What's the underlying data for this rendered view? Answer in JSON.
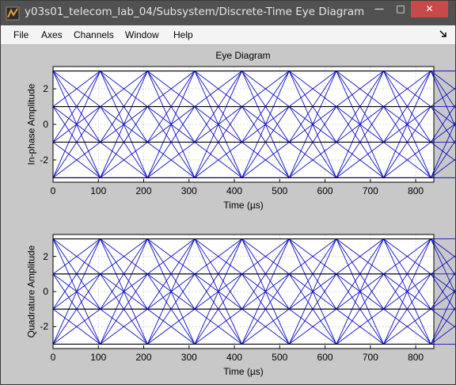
{
  "window": {
    "title": "y03s01_telecom_lab_04/Subsystem/Discrete-Time Eye Diagram ...",
    "minimize_glyph": "—",
    "maximize_glyph": "□",
    "close_glyph": "✕"
  },
  "menu": [
    "File",
    "Axes",
    "Channels",
    "Window",
    "Help"
  ],
  "plot_title": "Eye Diagram",
  "colors": {
    "trace": "#1010c8",
    "level": "#000000",
    "grid": "#cfcfcf",
    "background": "#c8c8c8"
  },
  "chart_data": [
    {
      "type": "line",
      "title": "Eye Diagram",
      "xlabel": "Time (µs)",
      "ylabel": "In-phase Amplitude",
      "xlim": [
        0,
        840
      ],
      "ylim": [
        -3.25,
        3.25
      ],
      "x_ticks": [
        0,
        100,
        200,
        300,
        400,
        500,
        600,
        700,
        800
      ],
      "y_ticks": [
        2,
        0,
        -2
      ],
      "symbol_period": 104.17,
      "levels": [
        -3,
        -1,
        1,
        3
      ],
      "grid": true
    },
    {
      "type": "line",
      "title": "",
      "xlabel": "Time (µs)",
      "ylabel": "Quadrature Amplitude",
      "xlim": [
        0,
        840
      ],
      "ylim": [
        -3.25,
        3.25
      ],
      "x_ticks": [
        0,
        100,
        200,
        300,
        400,
        500,
        600,
        700,
        800
      ],
      "y_ticks": [
        2,
        0,
        -2
      ],
      "symbol_period": 104.17,
      "levels": [
        -3,
        -1,
        1,
        3
      ],
      "grid": true
    }
  ]
}
